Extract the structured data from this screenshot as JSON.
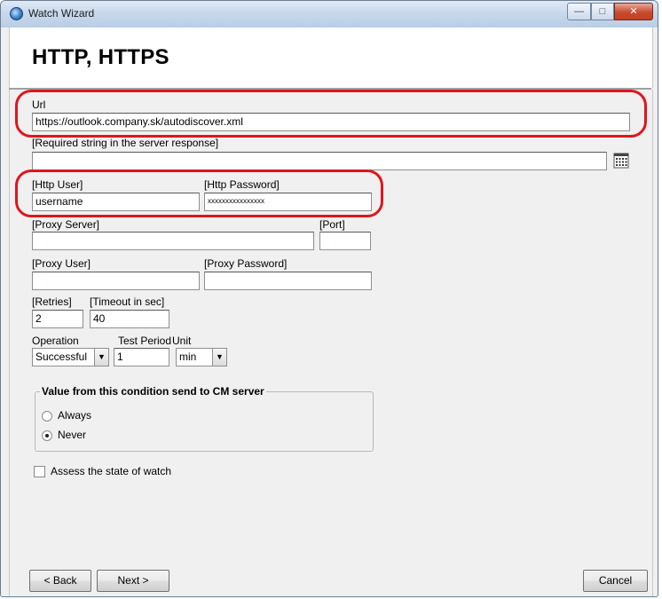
{
  "window": {
    "title": "Watch Wizard",
    "min_glyph": "—",
    "max_glyph": "□",
    "close_glyph": "✕"
  },
  "header": {
    "title": "HTTP, HTTPS"
  },
  "url": {
    "label": "Url",
    "value": "https://outlook.company.sk/autodiscover.xml"
  },
  "required_string": {
    "label": "[Required string in the server response]",
    "value": ""
  },
  "http_user": {
    "label": "[Http User]",
    "value": "username"
  },
  "http_password": {
    "label": "[Http Password]",
    "value": "xxxxxxxxxxxxxxxx"
  },
  "proxy_server": {
    "label": "[Proxy Server]",
    "value": ""
  },
  "port": {
    "label": "[Port]",
    "value": ""
  },
  "proxy_user": {
    "label": "[Proxy User]",
    "value": ""
  },
  "proxy_password": {
    "label": "[Proxy Password]",
    "value": ""
  },
  "retries": {
    "label": "[Retries]",
    "value": "2"
  },
  "timeout": {
    "label": "[Timeout in sec]",
    "value": "40"
  },
  "operation": {
    "label": "Operation",
    "value": "Successful"
  },
  "test_period": {
    "label": "Test Period",
    "value": "1"
  },
  "unit": {
    "label": "Unit",
    "value": "min"
  },
  "send_group": {
    "legend": "Value from this condition send to CM server",
    "options": [
      {
        "label": "Always",
        "selected": false
      },
      {
        "label": "Never",
        "selected": true
      }
    ]
  },
  "assess": {
    "label": "Assess the state of watch",
    "checked": false
  },
  "footer": {
    "back_label": "< Back",
    "next_label": "Next >",
    "cancel_label": "Cancel"
  },
  "colors": {
    "annotation_red": "#e0151d",
    "panel_bg": "#f0f0f0"
  },
  "icons": {
    "dictionary_button": "dictionary-icon",
    "app": "app-icon"
  }
}
